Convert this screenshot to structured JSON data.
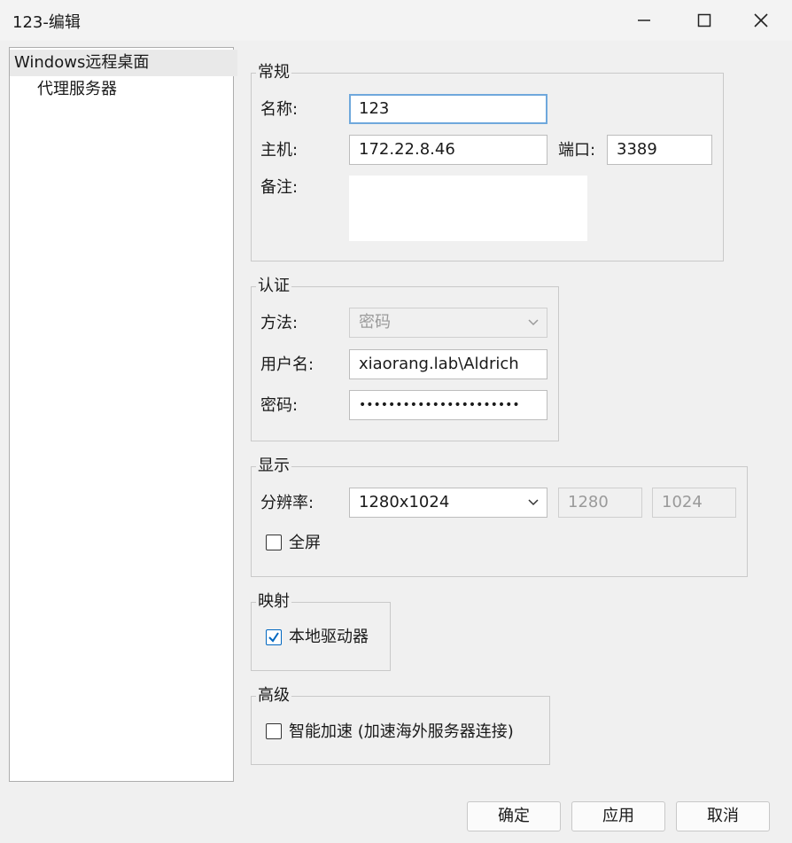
{
  "window": {
    "title": "123-编辑"
  },
  "nav": {
    "items": [
      "Windows远程桌面",
      "代理服务器"
    ]
  },
  "general": {
    "legend": "常规",
    "name_label": "名称:",
    "name_value": "123",
    "host_label": "主机:",
    "host_value": "172.22.8.46",
    "port_label": "端口:",
    "port_value": "3389",
    "notes_label": "备注:"
  },
  "auth": {
    "legend": "认证",
    "method_label": "方法:",
    "method_value": "密码",
    "username_label": "用户名:",
    "username_value": "xiaorang.lab\\Aldrich",
    "password_label": "密码:",
    "password_masked": "••••••••••••••••••••••"
  },
  "display": {
    "legend": "显示",
    "resolution_label": "分辨率:",
    "resolution_value": "1280x1024",
    "width_value": "1280",
    "height_value": "1024",
    "fullscreen_label": "全屏",
    "fullscreen_checked": false
  },
  "mapping": {
    "legend": "映射",
    "local_drive_label": "本地驱动器",
    "local_drive_checked": true
  },
  "advanced": {
    "legend": "高级",
    "smart_accel_label": "智能加速 (加速海外服务器连接)",
    "smart_accel_checked": false
  },
  "buttons": {
    "ok": "确定",
    "apply": "应用",
    "cancel": "取消"
  },
  "colors": {
    "accent": "#0067c0",
    "focus_border": "#6fa8dc",
    "disabled_text": "#9a9a9a"
  }
}
